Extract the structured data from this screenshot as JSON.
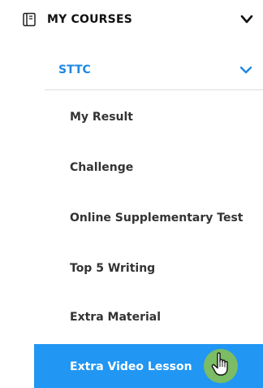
{
  "section": {
    "title": "MY COURSES",
    "icon": "book-icon",
    "chevron_icon": "chevron-down-icon"
  },
  "course": {
    "title": "STTC",
    "chevron_icon": "chevron-down-icon",
    "accent_color": "#1e88e5"
  },
  "menu": {
    "items": [
      {
        "label": "My Result"
      },
      {
        "label": "Challenge"
      },
      {
        "label": "Online Supplementary Test"
      },
      {
        "label": "Top 5 Writing"
      },
      {
        "label": "Extra Material"
      },
      {
        "label": "Extra Video Lesson"
      }
    ],
    "active_index": 5,
    "active_color": "#2196f3"
  },
  "cursor": {
    "icon": "hand-pointer-icon",
    "halo_color": "#8bc34a"
  }
}
